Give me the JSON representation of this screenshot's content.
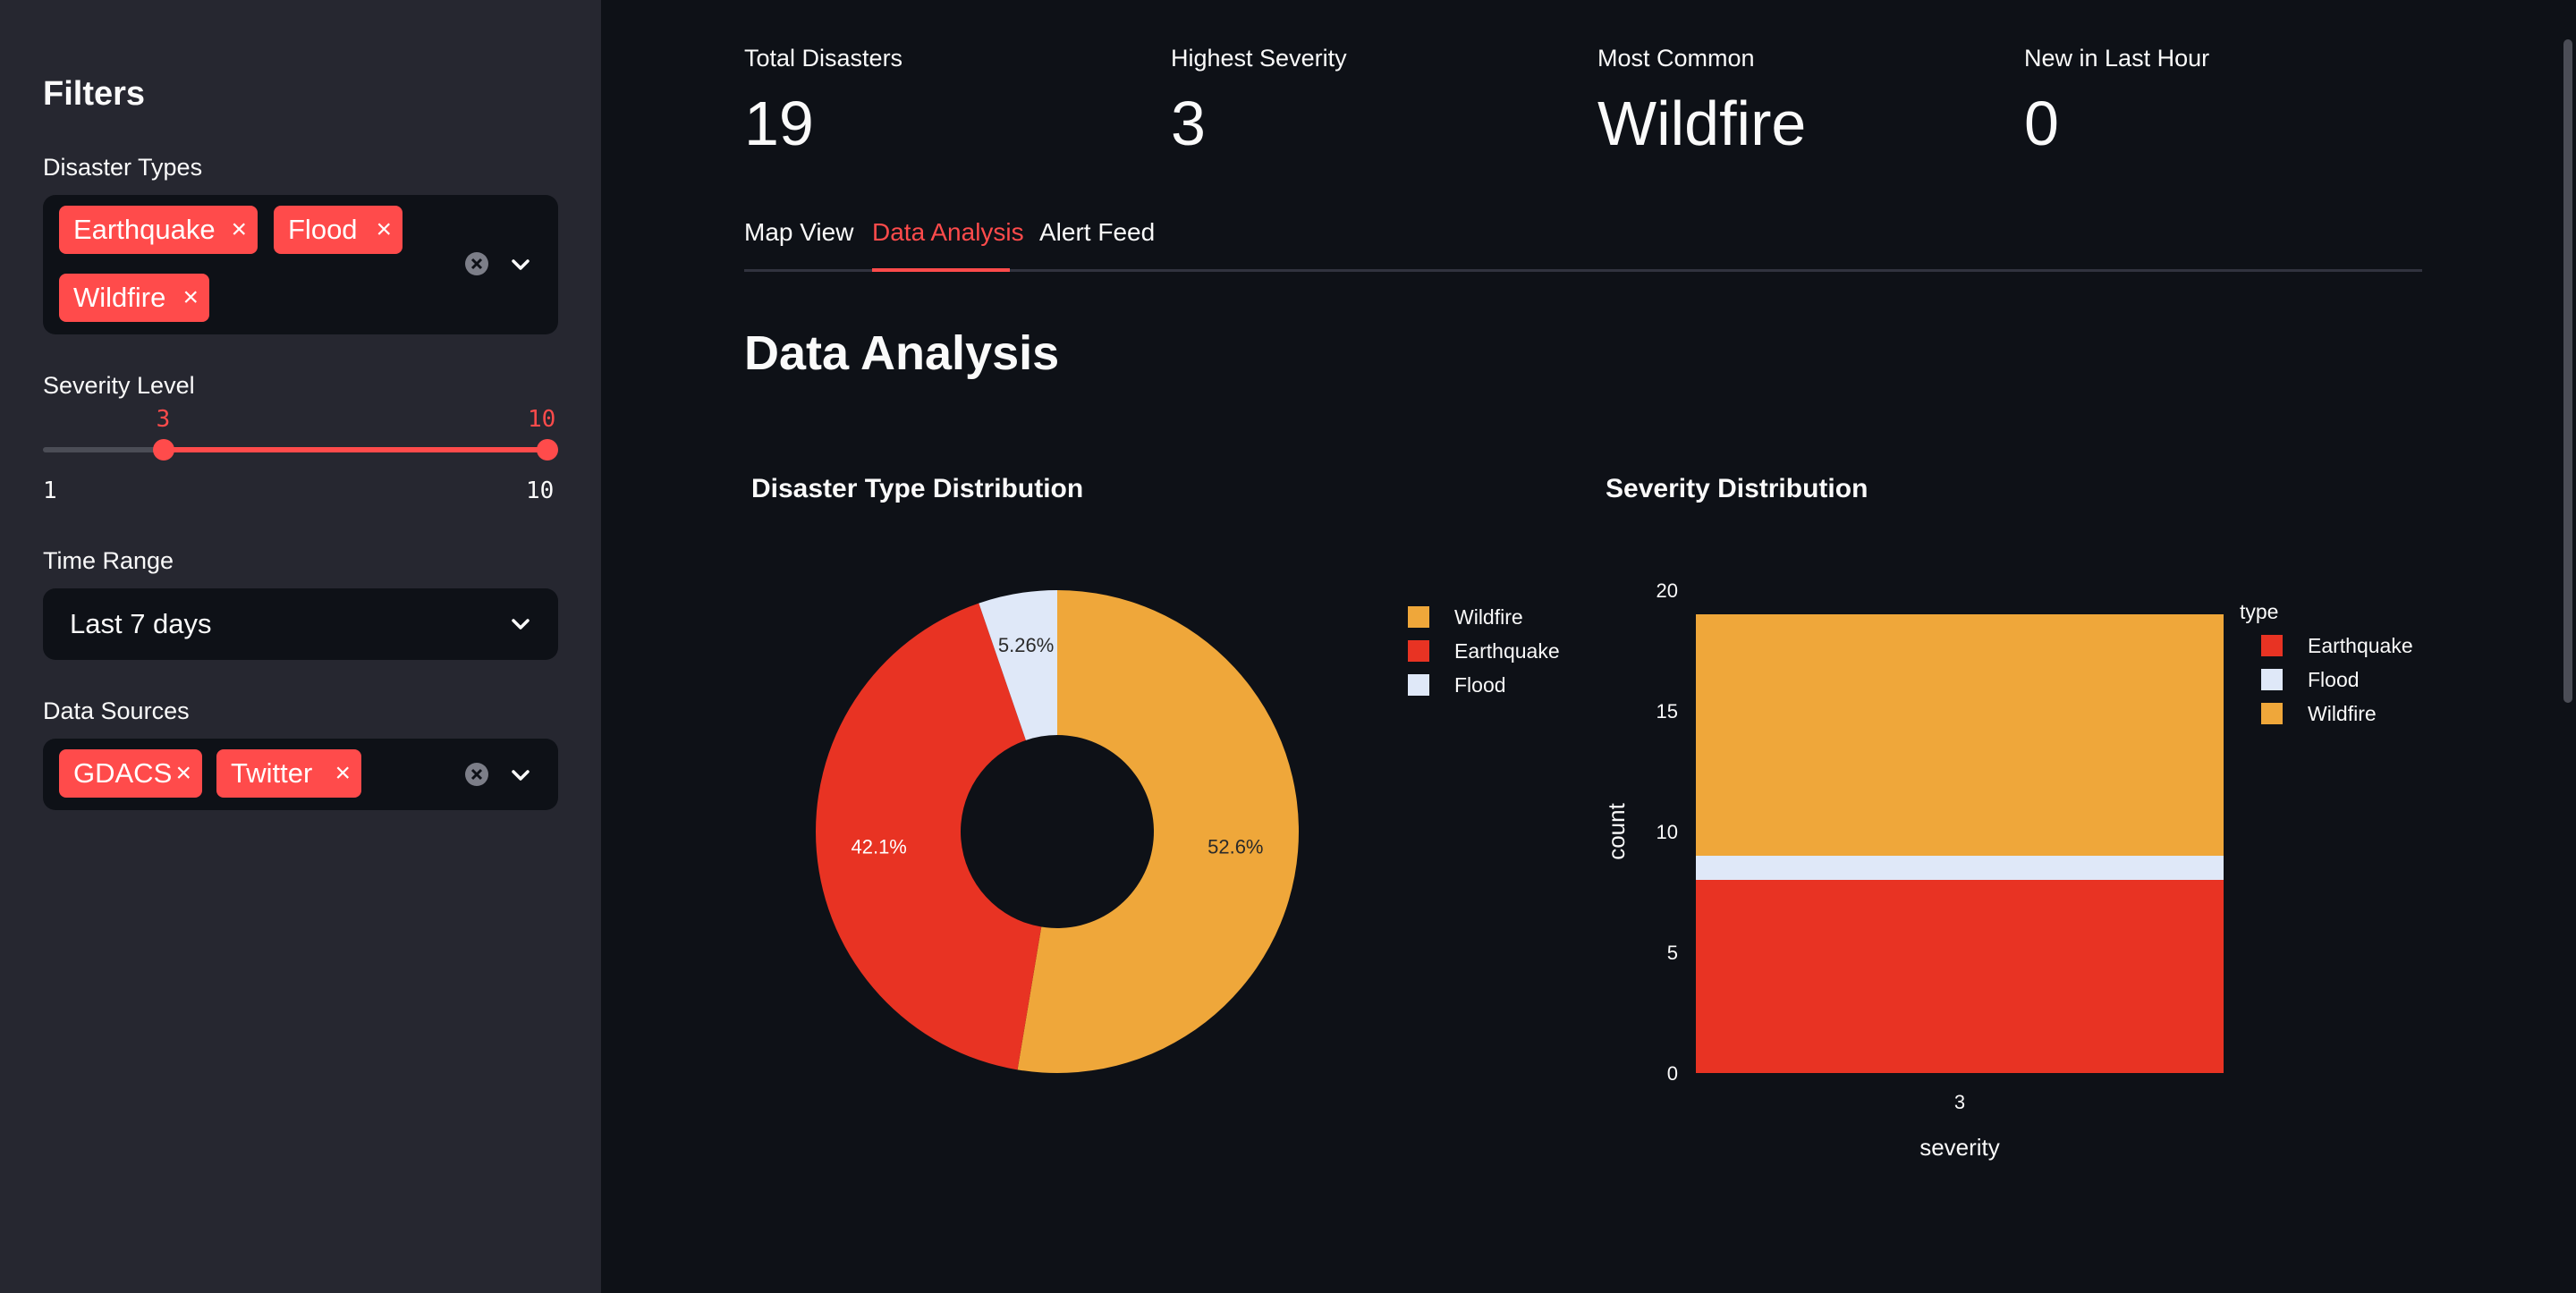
{
  "sidebar": {
    "title": "Filters",
    "disaster_types": {
      "label": "Disaster Types",
      "chips": [
        "Earthquake",
        "Flood",
        "Wildfire"
      ],
      "remove_glyph": "×"
    },
    "severity": {
      "label": "Severity Level",
      "min": 1,
      "max": 10,
      "low": 3,
      "high": 10,
      "min_label": "1",
      "max_label": "10",
      "low_label": "3",
      "high_label": "10"
    },
    "time_range": {
      "label": "Time Range",
      "value": "Last 7 days"
    },
    "data_sources": {
      "label": "Data Sources",
      "chips": [
        "GDACS",
        "Twitter"
      ],
      "remove_glyph": "×"
    }
  },
  "metrics": [
    {
      "label": "Total Disasters",
      "value": "19"
    },
    {
      "label": "Highest Severity",
      "value": "3"
    },
    {
      "label": "Most Common",
      "value": "Wildfire"
    },
    {
      "label": "New in Last Hour",
      "value": "0"
    }
  ],
  "tabs": [
    "Map View",
    "Data Analysis",
    "Alert Feed"
  ],
  "active_tab": "Data Analysis",
  "page_title": "Data Analysis",
  "colors": {
    "accent": "#ff4b4b",
    "wildfire": "#efa73a",
    "earthquake": "#e83323",
    "flood": "#dfe8f8"
  },
  "icons": [
    "close-icon",
    "clear-icon",
    "chevron-down-icon"
  ],
  "chart_data": [
    {
      "type": "pie",
      "title": "Disaster Type Distribution",
      "hole": true,
      "labels": [
        "Wildfire",
        "Earthquake",
        "Flood"
      ],
      "values": [
        10,
        8,
        1
      ],
      "percent_labels": [
        "52.6%",
        "42.1%",
        "5.26%"
      ],
      "legend": [
        "Wildfire",
        "Earthquake",
        "Flood"
      ],
      "legend_position": "top-right"
    },
    {
      "type": "bar",
      "title": "Severity Distribution",
      "stacked": true,
      "categories": [
        "3"
      ],
      "xlabel": "severity",
      "ylabel": "count",
      "ylim": [
        0,
        20
      ],
      "yticks": [
        0,
        5,
        10,
        15,
        20
      ],
      "legend_title": "type",
      "legend_position": "top-right",
      "series": [
        {
          "name": "Earthquake",
          "values": [
            8
          ]
        },
        {
          "name": "Flood",
          "values": [
            1
          ]
        },
        {
          "name": "Wildfire",
          "values": [
            10
          ]
        }
      ]
    }
  ]
}
